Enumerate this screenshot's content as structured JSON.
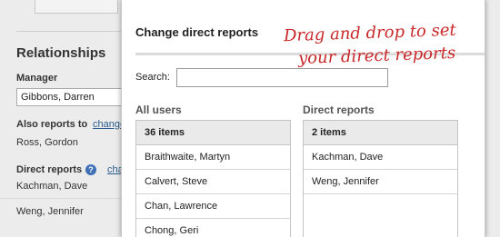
{
  "background": {
    "section_title": "Relationships",
    "manager_label": "Manager",
    "manager_value": "Gibbons, Darren",
    "also_reports_label": "Also reports to",
    "also_reports_link": "change",
    "also_reports_value": "Ross, Gordon",
    "direct_reports_label": "Direct reports",
    "direct_reports_link": "change",
    "direct_reports_values": [
      "Kachman, Dave",
      "Weng, Jennifer"
    ]
  },
  "modal": {
    "title": "Change direct reports",
    "search_label": "Search:",
    "search_value": "",
    "all_users": {
      "heading": "All users",
      "count": "36 items",
      "items": [
        "Braithwaite, Martyn",
        "Calvert, Steve",
        "Chan, Lawrence",
        "Chong, Geri"
      ]
    },
    "direct_reports": {
      "heading": "Direct reports",
      "count": "2 items",
      "items": [
        "Kachman, Dave",
        "Weng, Jennifer"
      ]
    }
  },
  "annotation": {
    "line1": "Drag and drop to set",
    "line2": "your direct reports",
    "color": "#c8282a"
  },
  "icons": {
    "help": "help-icon"
  },
  "colors": {
    "link": "#2a5a8e",
    "help_icon": "#3f6fb5"
  }
}
